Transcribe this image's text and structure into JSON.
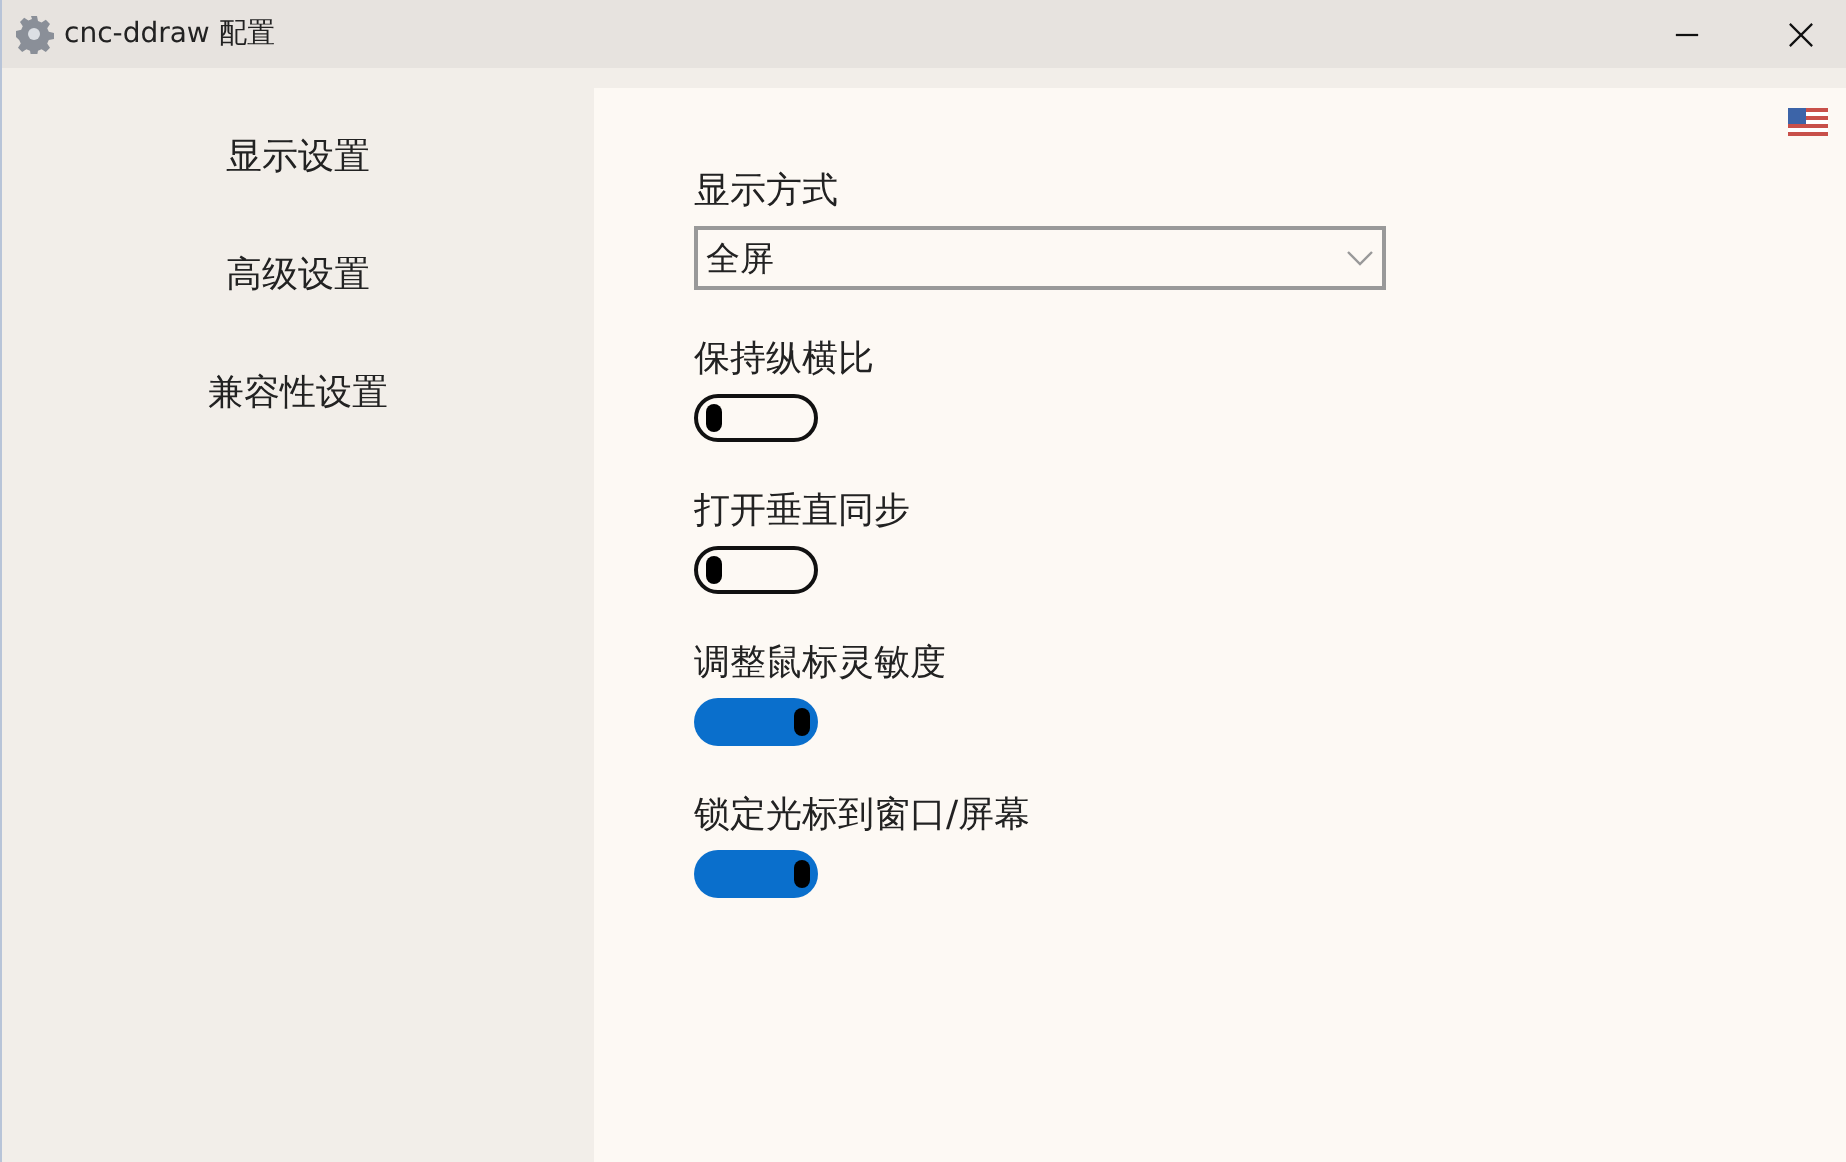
{
  "window": {
    "title": "cnc-ddraw 配置"
  },
  "sidebar": {
    "items": [
      {
        "label": "显示设置"
      },
      {
        "label": "高级设置"
      },
      {
        "label": "兼容性设置"
      }
    ]
  },
  "settings": [
    {
      "kind": "dropdown",
      "label": "显示方式",
      "value": "全屏"
    },
    {
      "kind": "toggle",
      "label": "保持纵横比",
      "on": false
    },
    {
      "kind": "toggle",
      "label": "打开垂直同步",
      "on": false
    },
    {
      "kind": "toggle",
      "label": "调整鼠标灵敏度",
      "on": true
    },
    {
      "kind": "toggle",
      "label": "锁定光标到窗口/屏幕",
      "on": true
    }
  ]
}
